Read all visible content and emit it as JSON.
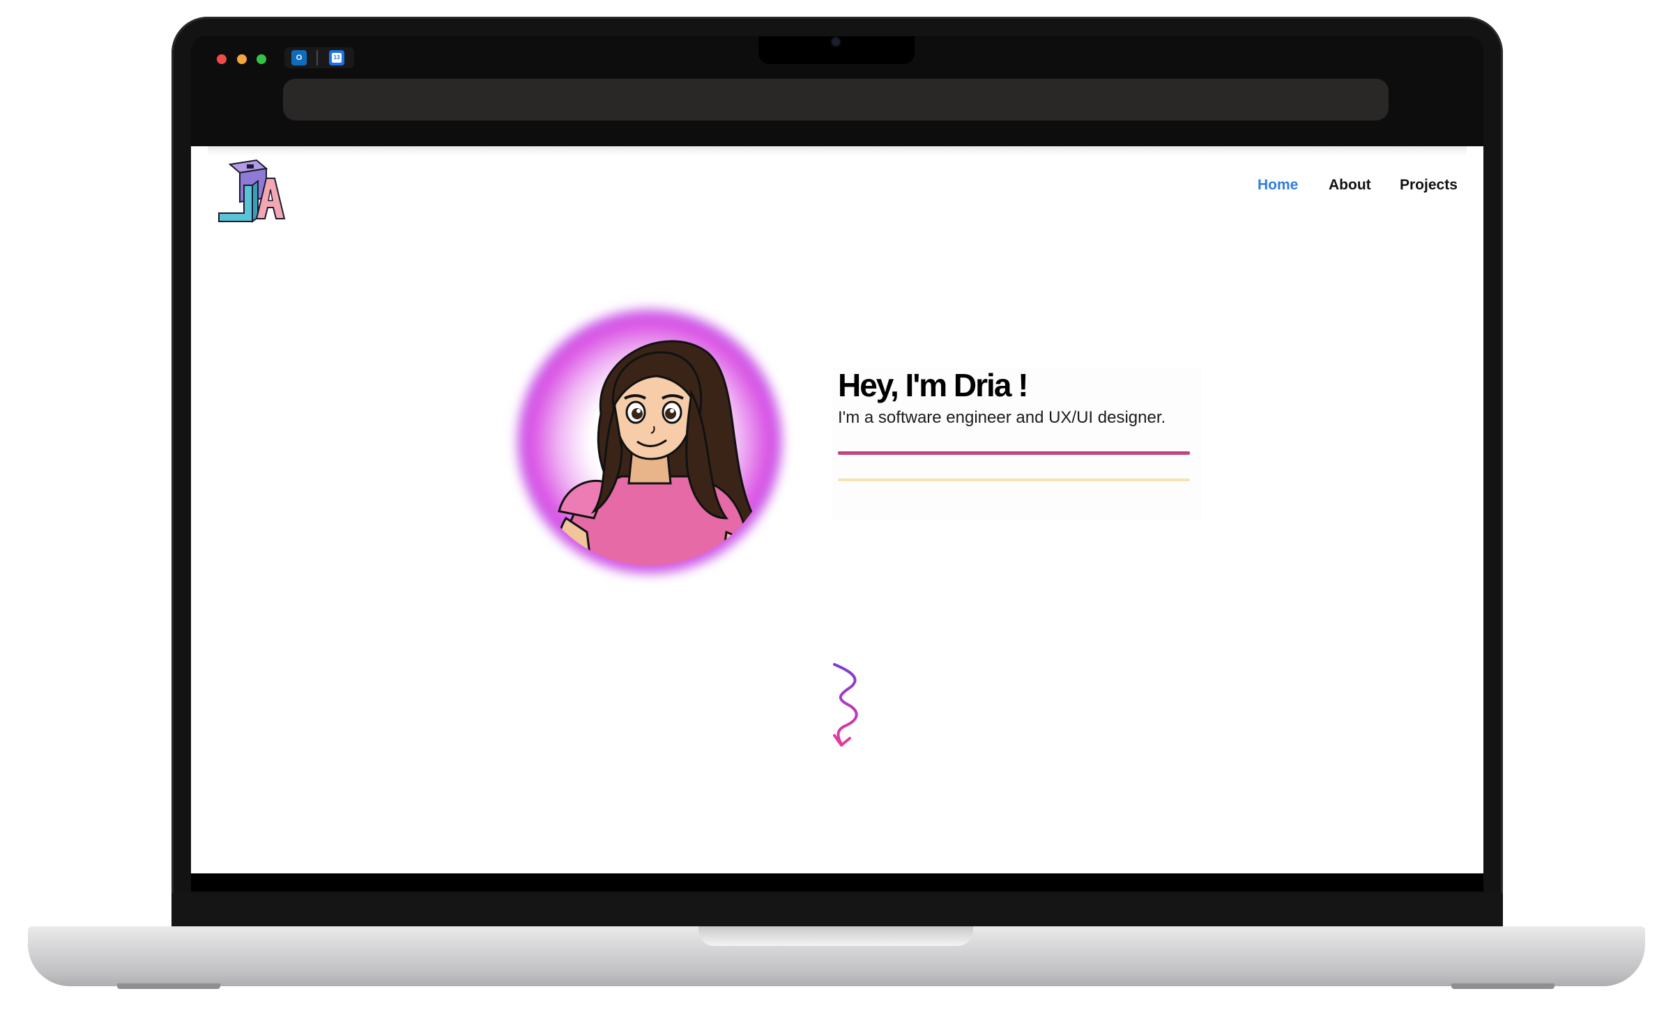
{
  "browser": {
    "tabs": [
      {
        "icon": "outlook-icon",
        "label": ""
      },
      {
        "icon": "calendar-icon",
        "label": "13"
      }
    ],
    "traffic_lights": [
      "#ee4c4c",
      "#f3a73c",
      "#2fc646"
    ]
  },
  "site": {
    "logo_text": "JA",
    "nav": {
      "home": "Home",
      "about": "About",
      "projects": "Projects",
      "active": "home"
    },
    "hero": {
      "headline": "Hey, I'm Dria !",
      "subtitle": "I'm a software engineer and UX/UI designer."
    },
    "colors": {
      "accent": "#2f7de1",
      "pink_rule": "#c9407f",
      "gold_rule": "#f7e3b2"
    },
    "icons": {
      "scroll": "squiggle-arrow-down-icon"
    }
  }
}
